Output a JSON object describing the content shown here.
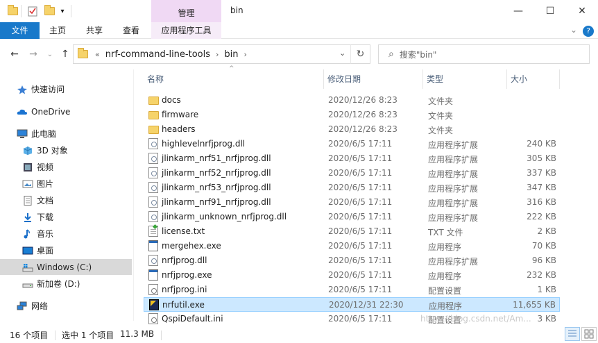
{
  "window": {
    "title": "bin",
    "context_tab": "管理",
    "controls": {
      "minimize": "—",
      "maximize": "☐",
      "close": "✕"
    }
  },
  "ribbon": {
    "tabs": [
      {
        "label": "文件",
        "active": true
      },
      {
        "label": "主页"
      },
      {
        "label": "共享"
      },
      {
        "label": "查看"
      },
      {
        "label": "应用程序工具"
      }
    ],
    "expand": "⌄",
    "help": "?"
  },
  "nav": {
    "back": "←",
    "forward": "→",
    "recent": "⌄",
    "up": "↑"
  },
  "address": {
    "prefix": "«",
    "crumbs": [
      "nrf-command-line-tools",
      "bin"
    ],
    "sep": "›",
    "dropdown": "⌄",
    "refresh": "↻"
  },
  "search": {
    "icon": "⌕",
    "placeholder": "搜索\"bin\""
  },
  "sidebar": {
    "items": [
      {
        "label": "快速访问",
        "icon": "star-icon"
      },
      {
        "label": "OneDrive",
        "icon": "cloud-icon"
      },
      {
        "label": "此电脑",
        "icon": "computer-icon"
      },
      {
        "label": "3D 对象",
        "icon": "cube-icon"
      },
      {
        "label": "视频",
        "icon": "video-icon"
      },
      {
        "label": "图片",
        "icon": "picture-icon"
      },
      {
        "label": "文档",
        "icon": "document-icon"
      },
      {
        "label": "下载",
        "icon": "download-icon"
      },
      {
        "label": "音乐",
        "icon": "music-icon"
      },
      {
        "label": "桌面",
        "icon": "desktop-icon"
      },
      {
        "label": "Windows (C:)",
        "icon": "drive-c-icon",
        "selected": true
      },
      {
        "label": "新加卷 (D:)",
        "icon": "drive-d-icon"
      },
      {
        "label": "网络",
        "icon": "network-icon"
      }
    ]
  },
  "columns": {
    "name": "名称",
    "date": "修改日期",
    "type": "类型",
    "size": "大小",
    "sort_indicator": "^"
  },
  "files": [
    {
      "name": "docs",
      "date": "2020/12/26 8:23",
      "type": "文件夹",
      "size": "",
      "icon": "folder-icon"
    },
    {
      "name": "firmware",
      "date": "2020/12/26 8:23",
      "type": "文件夹",
      "size": "",
      "icon": "folder-icon"
    },
    {
      "name": "headers",
      "date": "2020/12/26 8:23",
      "type": "文件夹",
      "size": "",
      "icon": "folder-icon"
    },
    {
      "name": "highlevelnrfjprog.dll",
      "date": "2020/6/5 17:11",
      "type": "应用程序扩展",
      "size": "240 KB",
      "icon": "dll-icon"
    },
    {
      "name": "jlinkarm_nrf51_nrfjprog.dll",
      "date": "2020/6/5 17:11",
      "type": "应用程序扩展",
      "size": "305 KB",
      "icon": "dll-icon"
    },
    {
      "name": "jlinkarm_nrf52_nrfjprog.dll",
      "date": "2020/6/5 17:11",
      "type": "应用程序扩展",
      "size": "337 KB",
      "icon": "dll-icon"
    },
    {
      "name": "jlinkarm_nrf53_nrfjprog.dll",
      "date": "2020/6/5 17:11",
      "type": "应用程序扩展",
      "size": "347 KB",
      "icon": "dll-icon"
    },
    {
      "name": "jlinkarm_nrf91_nrfjprog.dll",
      "date": "2020/6/5 17:11",
      "type": "应用程序扩展",
      "size": "316 KB",
      "icon": "dll-icon"
    },
    {
      "name": "jlinkarm_unknown_nrfjprog.dll",
      "date": "2020/6/5 17:11",
      "type": "应用程序扩展",
      "size": "222 KB",
      "icon": "dll-icon"
    },
    {
      "name": "license.txt",
      "date": "2020/6/5 17:11",
      "type": "TXT 文件",
      "size": "2 KB",
      "icon": "txt-icon"
    },
    {
      "name": "mergehex.exe",
      "date": "2020/6/5 17:11",
      "type": "应用程序",
      "size": "70 KB",
      "icon": "exe-icon"
    },
    {
      "name": "nrfjprog.dll",
      "date": "2020/6/5 17:11",
      "type": "应用程序扩展",
      "size": "96 KB",
      "icon": "dll-icon"
    },
    {
      "name": "nrfjprog.exe",
      "date": "2020/6/5 17:11",
      "type": "应用程序",
      "size": "232 KB",
      "icon": "exe-icon"
    },
    {
      "name": "nrfjprog.ini",
      "date": "2020/6/5 17:11",
      "type": "配置设置",
      "size": "1 KB",
      "icon": "ini-icon"
    },
    {
      "name": "nrfutil.exe",
      "date": "2020/12/31 22:30",
      "type": "应用程序",
      "size": "11,655 KB",
      "icon": "nrfutil-icon",
      "selected": true
    },
    {
      "name": "QspiDefault.ini",
      "date": "2020/6/5 17:11",
      "type": "配置设置",
      "size": "3 KB",
      "icon": "ini-icon"
    }
  ],
  "status": {
    "count": "16 个项目",
    "selected": "选中 1 个项目",
    "size": "11.3 MB"
  },
  "watermark": "https://blog.csdn.net/Am...",
  "colors": {
    "accent": "#1979ca",
    "selection": "#cce8ff",
    "context_tab": "#f0d9f4"
  }
}
